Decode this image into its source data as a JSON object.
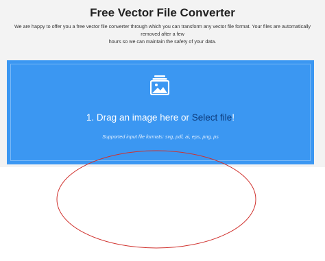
{
  "header": {
    "title": "Free Vector File Converter",
    "intro_line1": "We are happy to offer you a free vector file converter through which you can transform any vector file format. Your files are automatically removed after a few",
    "intro_line2": "hours so we can maintain the safety of your data."
  },
  "dropzone": {
    "icon": "image-stack-icon",
    "drag_text": "1. Drag an image here or ",
    "select_link": "Select file",
    "select_suffix": "!",
    "formats_text": "Supported input file formats: svg, pdf, ai, eps, png, ps"
  },
  "colors": {
    "dropzone_bg": "#3b97f2",
    "annotation_ellipse": "#d0312d"
  }
}
